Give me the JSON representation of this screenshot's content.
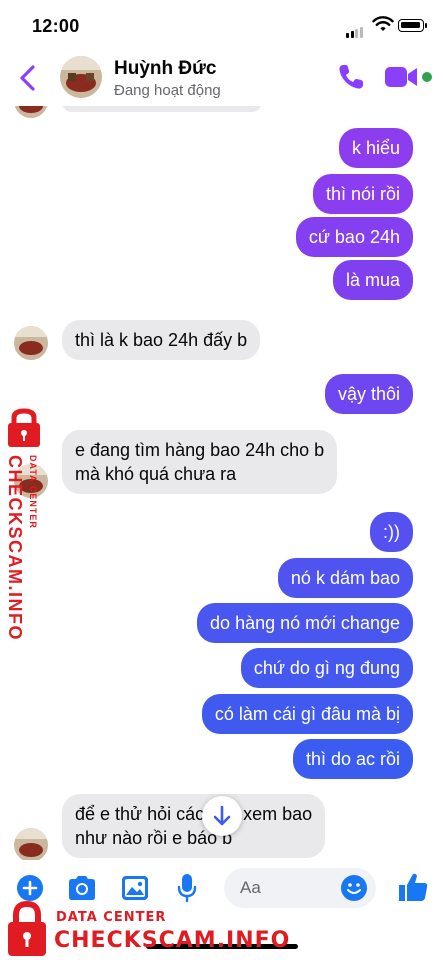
{
  "status_bar": {
    "time": "12:00"
  },
  "header": {
    "contact_name": "Huỳnh Đức",
    "contact_status": "Đang hoạt động"
  },
  "messages": [
    {
      "side": "out",
      "text": "k hiểu"
    },
    {
      "side": "out",
      "text": "thì nói rồi"
    },
    {
      "side": "out",
      "text": "cứ bao 24h"
    },
    {
      "side": "out",
      "text": "là mua"
    },
    {
      "side": "in",
      "text": "thì là k bao 24h đấy b"
    },
    {
      "side": "out",
      "text": "vậy thôi"
    },
    {
      "side": "in",
      "line1": "e đang tìm hàng bao 24h cho b",
      "line2": "mà khó quá chưa ra"
    },
    {
      "side": "out",
      "text": ":))"
    },
    {
      "side": "out",
      "text": "nó k dám bao"
    },
    {
      "side": "out",
      "text": "do hàng nó mới change"
    },
    {
      "side": "out",
      "text": "chứ do gì ng đung"
    },
    {
      "side": "out",
      "text": "có làm cái gì đâu mà bị"
    },
    {
      "side": "out",
      "text": "thì do ac rồi"
    },
    {
      "side": "in",
      "line1": "để e thử hỏi các bác xem bao",
      "line2": "như nào rồi e báo b"
    }
  ],
  "composer": {
    "placeholder": "Aa"
  },
  "colors": {
    "accent": "#8a3ffc",
    "bubble_purple": "#8b3ff0",
    "bubble_blue": "#3b5cf0",
    "incoming_bubble": "#e9e9eb",
    "watermark": "#e11b22"
  },
  "watermark": {
    "side_sub": "DATA CENTER",
    "side_main": "CHECKSCAM.INFO",
    "bottom_sub": "DATA CENTER",
    "bottom_main": "CHECKSCAM.INFO"
  }
}
